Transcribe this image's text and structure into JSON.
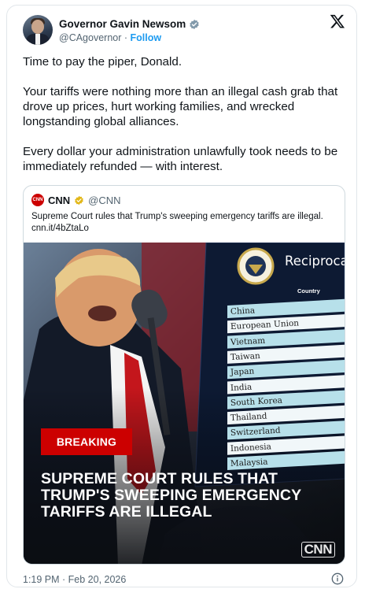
{
  "author": {
    "display_name": "Governor Gavin Newsom",
    "handle": "@CAgovernor",
    "separator": "·",
    "follow_label": "Follow",
    "verified_icon": "verified-badge-icon"
  },
  "tweet": {
    "paragraphs": [
      "Time to pay the piper, Donald.",
      "Your tariffs were nothing more than an illegal cash grab that drove up prices, hurt working families, and wrecked longstanding global alliances.",
      "Every dollar your administration unlawfully took needs to be immediately refunded — with interest."
    ],
    "timestamp": "1:19 PM · Feb 20, 2026"
  },
  "quote": {
    "name": "CNN",
    "handle": "@CNN",
    "avatar_text": "CNN",
    "text": "Supreme Court rules that Trump's sweeping emergency tariffs are illegal.",
    "link": "cnn.it/4bZtaLo",
    "image": {
      "breaking_label": "BREAKING",
      "headline": "SUPREME COURT RULES THAT TRUMP'S SWEEPING EMERGENCY TARIFFS ARE ILLEGAL",
      "watermark": "CNN",
      "board_title": "Reciprocal",
      "board_column": "Country",
      "countries": [
        "China",
        "European Union",
        "Vietnam",
        "Taiwan",
        "Japan",
        "India",
        "South Korea",
        "Thailand",
        "Switzerland",
        "Indonesia",
        "Malaysia"
      ]
    }
  },
  "colors": {
    "accent_blue": "#1d9bf0",
    "cnn_red": "#cc0000",
    "muted_text": "#536471",
    "verified_gold": "#e2b719"
  }
}
